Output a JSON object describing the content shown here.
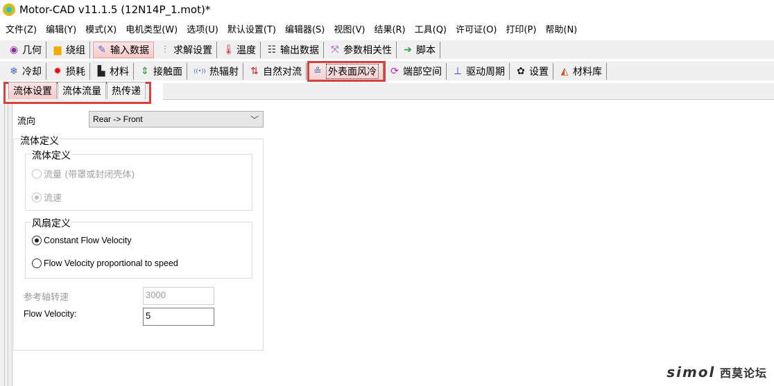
{
  "window": {
    "title": "Motor-CAD v11.1.5 (12N14P_1.mot)*"
  },
  "menu": [
    "文件(Z)",
    "编辑(Y)",
    "模式(X)",
    "电机类型(W)",
    "选项(U)",
    "默认设置(T)",
    "编辑器(S)",
    "视图(V)",
    "结果(R)",
    "工具(Q)",
    "许可证(O)",
    "打印(P)",
    "帮助(N)"
  ],
  "main_tabs": [
    {
      "label": "几何",
      "icon": "geometry-icon",
      "glyph": "◉",
      "color": "#8b2fa0"
    },
    {
      "label": "绕组",
      "icon": "winding-icon",
      "glyph": "▆",
      "color": "#f5a800"
    },
    {
      "label": "输入数据",
      "icon": "input-data-icon",
      "glyph": "✎",
      "color": "#3a6fc4",
      "active": true
    },
    {
      "label": "求解设置",
      "icon": "solver-settings-icon",
      "glyph": "⫶",
      "color": "#2d6fd1"
    },
    {
      "label": "温度",
      "icon": "temperature-icon",
      "glyph": "🌡",
      "color": "#d9302f"
    },
    {
      "label": "输出数据",
      "icon": "output-data-icon",
      "glyph": "☷",
      "color": "#333333"
    },
    {
      "label": "参数相关性",
      "icon": "sensitivity-icon",
      "glyph": "⤧",
      "color": "#9b3fd0"
    },
    {
      "label": "脚本",
      "icon": "script-icon",
      "glyph": "➔",
      "color": "#2a9e3a"
    }
  ],
  "sub_tabs": [
    {
      "label": "冷却",
      "icon": "cooling-icon",
      "glyph": "❄",
      "color": "#3a66c8"
    },
    {
      "label": "损耗",
      "icon": "losses-icon",
      "glyph": "✹",
      "color": "#e01010"
    },
    {
      "label": "材料",
      "icon": "materials-icon",
      "glyph": "▙",
      "color": "#222222"
    },
    {
      "label": "接触面",
      "icon": "interfaces-icon",
      "glyph": "⇕",
      "color": "#2a8e3a"
    },
    {
      "label": "热辐射",
      "icon": "radiation-icon",
      "glyph": "((•))",
      "color": "#3a66c8"
    },
    {
      "label": "自然对流",
      "icon": "natural-convection-icon",
      "glyph": "⇅",
      "color": "#d02020"
    },
    {
      "label": "外表面风冷",
      "icon": "housing-water-jacket-icon",
      "glyph": "≗",
      "color": "#2a72c8",
      "highlight": true
    },
    {
      "label": "端部空间",
      "icon": "end-space-icon",
      "glyph": "⟳",
      "color": "#c020c0"
    },
    {
      "label": "驱动周期",
      "icon": "duty-cycle-icon",
      "glyph": "⊥",
      "color": "#2040d0"
    },
    {
      "label": "设置",
      "icon": "settings-icon",
      "glyph": "✿",
      "color": "#222222"
    },
    {
      "label": "材料库",
      "icon": "materials-database-icon",
      "glyph": "◭",
      "color": "#e05020"
    }
  ],
  "inner_tabs": [
    {
      "label": "流体设置",
      "active": true
    },
    {
      "label": "流体流量"
    },
    {
      "label": "热传递"
    }
  ],
  "form": {
    "flow_direction_label": "流向",
    "flow_direction_value": "Rear -> Front",
    "fluid_definition_outer": "流体定义",
    "fluid_definition_inner": "流体定义",
    "radio_flow_rate": "流量 (带罩或封闭壳体)",
    "radio_flow_velocity": "流速",
    "fan_definition": "风扇定义",
    "radio_constant_velocity": "Constant Flow Velocity",
    "radio_velocity_proportional": "Flow Velocity proportional to speed",
    "reference_speed_label": "参考轴转速",
    "reference_speed_value": "3000",
    "flow_velocity_label": "Flow Velocity:",
    "flow_velocity_value": "5"
  },
  "watermark": {
    "brand": "simol",
    "text": "西莫论坛"
  }
}
